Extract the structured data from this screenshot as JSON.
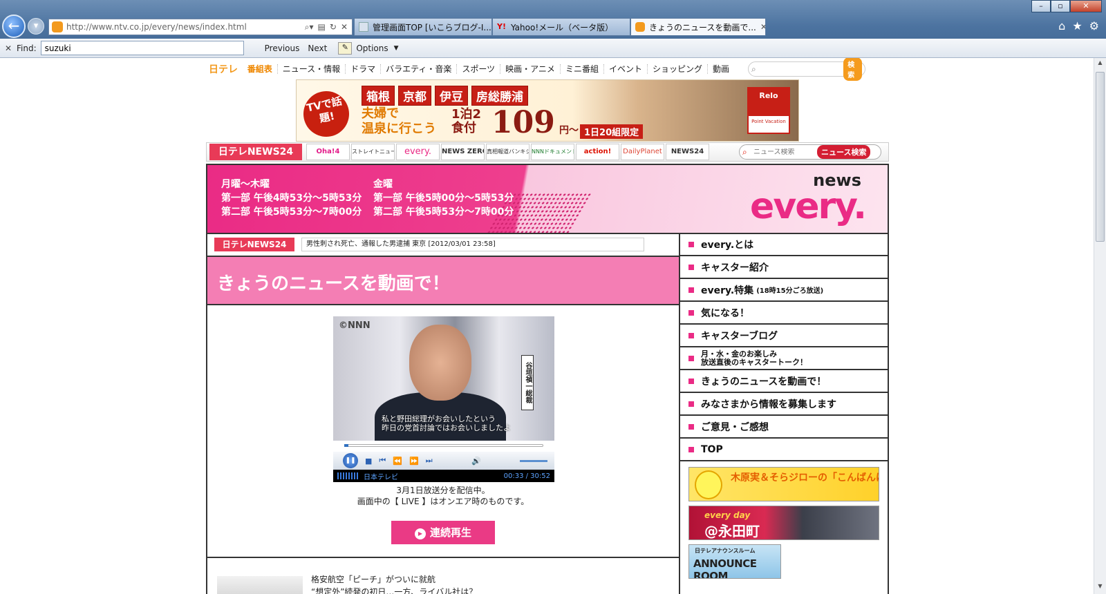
{
  "browser": {
    "url": "http://www.ntv.co.jp/every/news/index.html",
    "tabs": [
      {
        "label": "管理画面TOP [いこらブログ-I..."
      },
      {
        "label": "Yahoo!メール（ベータ版）"
      },
      {
        "label": "きょうのニュースを動画で..."
      }
    ],
    "find": {
      "label": "Find:",
      "value": "suzuki",
      "previous": "Previous",
      "next": "Next",
      "options": "Options"
    }
  },
  "topnav": {
    "logo": "日テレ",
    "items": [
      "番組表",
      "ニュース・情報",
      "ドラマ",
      "バラエティ・音楽",
      "スポーツ",
      "映画・アニメ",
      "ミニ番組",
      "イベント",
      "ショッピング",
      "動画"
    ],
    "search_button": "検索"
  },
  "ad": {
    "badge": "TVで話題!",
    "places": [
      "箱根",
      "京都",
      "伊豆",
      "房総勝浦"
    ],
    "line1": "夫婦で",
    "line2": "温泉に行こう",
    "meal": "1泊2食付",
    "price": "109",
    "yen": "円〜",
    "limit": "1日20組限定",
    "brand": "Relo",
    "brand_sub": "Point Vacation"
  },
  "n24bar": {
    "logo": "日テレNEWS24",
    "programs": [
      "Oha!4",
      "ストレイトニュース",
      "every.",
      "NEWS ZERO",
      "真相報道バンキシャ!",
      "NNNドキュメント",
      "action!",
      "DailyPlanet",
      "NEWS24"
    ],
    "search_placeholder": "ニュース検索",
    "search_button": "ニュース検索"
  },
  "banner": {
    "col1": [
      "月曜〜木曜",
      "第一部 午後4時53分〜5時53分",
      "第二部 午後5時53分〜7時00分"
    ],
    "col2": [
      "金曜",
      "第一部 午後5時00分〜5時53分",
      "第二部 午後5時53分〜7時00分"
    ],
    "logo_news": "news",
    "logo_every": "every."
  },
  "ticker": {
    "logo": "日テレNEWS24",
    "text": "男性刺され死亡、通報した男逮捕 東京 [2012/03/01 23:58]"
  },
  "main": {
    "heading": "きょうのニュースを動画で！",
    "video": {
      "source": "©NNN",
      "caption1": "私と野田総理がお会いしたという",
      "caption2": "昨日の党首討論ではお会いしましたよ",
      "name_card": "谷垣禎一総裁",
      "channel": "日本テレビ",
      "time": "00:33 / 30:52",
      "progress": 0.02
    },
    "note1": "3月1日放送分を配信中。",
    "note2": "画面中の【 LIVE 】はオンエア時のものです。",
    "play_button": "連続再生",
    "next_article_1": "格安航空「ピーチ」がついに就航",
    "next_article_2": "“想定外”続発の初日…一方、ライバル社は？"
  },
  "sidebar": {
    "items": [
      {
        "label": "every.とは"
      },
      {
        "label": "キャスター紹介"
      },
      {
        "label": "every.特集",
        "small": "(18時15分ごろ放送)"
      },
      {
        "label": "気になる！"
      },
      {
        "label": "キャスターブログ"
      },
      {
        "label": "月・水・金のお楽しみ",
        "label2": "放送直後のキャスタートーク！"
      },
      {
        "label": "きょうのニュースを動画で！"
      },
      {
        "label": "みなさまから情報を募集します"
      },
      {
        "label": "ご意見・ご感想"
      },
      {
        "label": "TOP"
      }
    ],
    "banner1": "木原実＆そらジローの「こんばんはーっ!」",
    "banner2_a": "every day",
    "banner2_b": "@永田町",
    "banner3_a": "日テレアナウンスルーム",
    "banner3_b": "ANNOUNCE ROOM"
  }
}
